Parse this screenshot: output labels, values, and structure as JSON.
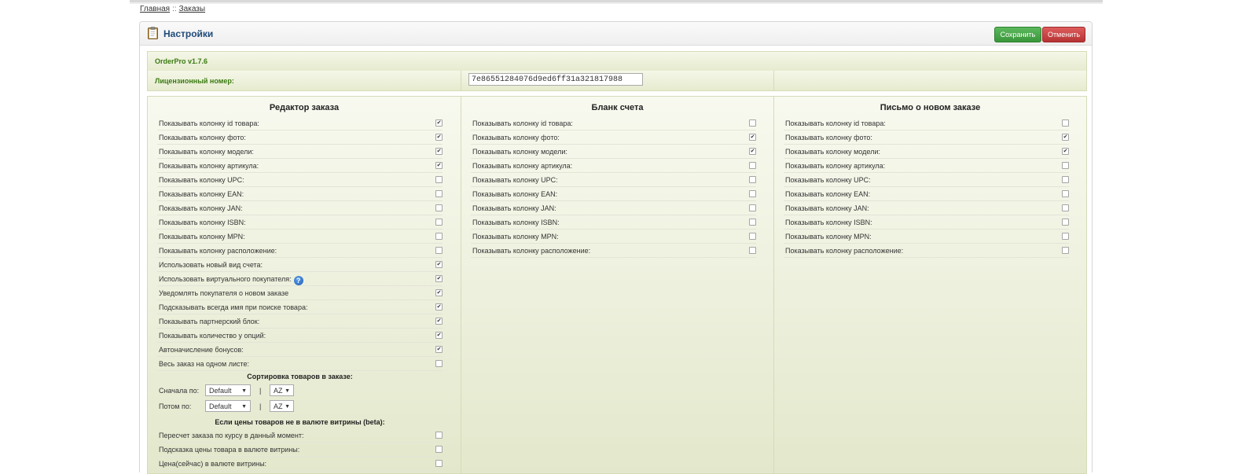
{
  "breadcrumb": {
    "home": "Главная",
    "separator": "::",
    "current": "Заказы"
  },
  "header": {
    "title": "Настройки",
    "save_label": "Сохранить",
    "cancel_label": "Отменить",
    "icon": "clipboard-icon"
  },
  "module": {
    "version": "OrderPro v1.7.6"
  },
  "license": {
    "label": "Лицензионный номер:",
    "value": "7e86551284076d9ed6ff31a321817988"
  },
  "colors": {
    "save": "#4cae4c",
    "cancel": "#c9302c",
    "label_green": "#3a7a12",
    "title_blue": "#1f4a78"
  },
  "columns": [
    {
      "title": "Редактор заказа",
      "rows": [
        {
          "label": "Показывать колонку id товара:",
          "checked": true
        },
        {
          "label": "Показывать колонку фото:",
          "checked": true
        },
        {
          "label": "Показывать колонку модели:",
          "checked": true
        },
        {
          "label": "Показывать колонку артикула:",
          "checked": true
        },
        {
          "label": "Показывать колонку UPC:",
          "checked": false
        },
        {
          "label": "Показывать колонку EAN:",
          "checked": false
        },
        {
          "label": "Показывать колонку JAN:",
          "checked": false
        },
        {
          "label": "Показывать колонку ISBN:",
          "checked": false
        },
        {
          "label": "Показывать колонку MPN:",
          "checked": false
        },
        {
          "label": "Показывать колонку расположение:",
          "checked": false
        },
        {
          "label": "Использовать новый вид счета:",
          "checked": true
        },
        {
          "label": "Использовать виртуального покупателя:",
          "checked": true,
          "help": true
        },
        {
          "label": "Уведомлять покупателя о новом заказе",
          "checked": true
        },
        {
          "label": "Подсказывать всегда имя при поиске товара:",
          "checked": true
        },
        {
          "label": "Показывать партнерский блок:",
          "checked": true
        },
        {
          "label": "Показывать количество у опций:",
          "checked": true
        },
        {
          "label": "Автоначисление бонусов:",
          "checked": true
        },
        {
          "label": "Весь заказ на одном листе:",
          "checked": false
        }
      ],
      "sort": {
        "title": "Сортировка товаров в заказе:",
        "first_label": "Сначала по:",
        "first_value": "Default",
        "first_order": "AZ",
        "then_label": "Потом по:",
        "then_value": "Default",
        "then_order": "AZ",
        "pipe": "|"
      },
      "currency": {
        "title": "Если цены товаров не в валюте витрины (beta):",
        "rows": [
          {
            "label": "Пересчет заказа по курсу в данный момент:",
            "checked": false
          },
          {
            "label": "Подсказка цены товара в валюте витрины:",
            "checked": false
          },
          {
            "label": "Цена(сейчас) в валюте витрины:",
            "checked": false
          }
        ]
      }
    },
    {
      "title": "Бланк счета",
      "rows": [
        {
          "label": "Показывать колонку id товара:",
          "checked": false
        },
        {
          "label": "Показывать колонку фото:",
          "checked": true
        },
        {
          "label": "Показывать колонку модели:",
          "checked": true
        },
        {
          "label": "Показывать колонку артикула:",
          "checked": false
        },
        {
          "label": "Показывать колонку UPC:",
          "checked": false
        },
        {
          "label": "Показывать колонку EAN:",
          "checked": false
        },
        {
          "label": "Показывать колонку JAN:",
          "checked": false
        },
        {
          "label": "Показывать колонку ISBN:",
          "checked": false
        },
        {
          "label": "Показывать колонку MPN:",
          "checked": false
        },
        {
          "label": "Показывать колонку расположение:",
          "checked": false
        }
      ]
    },
    {
      "title": "Письмо о новом заказе",
      "rows": [
        {
          "label": "Показывать колонку id товара:",
          "checked": false
        },
        {
          "label": "Показывать колонку фото:",
          "checked": true
        },
        {
          "label": "Показывать колонку модели:",
          "checked": true
        },
        {
          "label": "Показывать колонку артикула:",
          "checked": false
        },
        {
          "label": "Показывать колонку UPC:",
          "checked": false
        },
        {
          "label": "Показывать колонку EAN:",
          "checked": false
        },
        {
          "label": "Показывать колонку JAN:",
          "checked": false
        },
        {
          "label": "Показывать колонку ISBN:",
          "checked": false
        },
        {
          "label": "Показывать колонку MPN:",
          "checked": false
        },
        {
          "label": "Показывать колонку расположение:",
          "checked": false
        }
      ]
    }
  ]
}
